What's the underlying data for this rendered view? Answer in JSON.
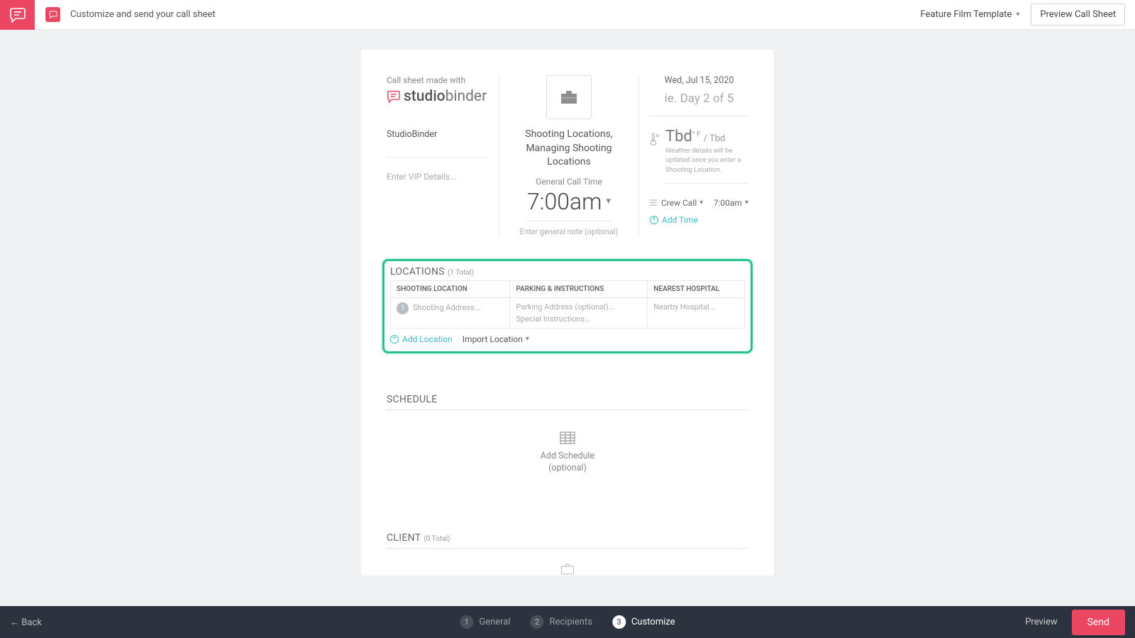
{
  "topbar": {
    "title": "Customize and send your call sheet",
    "template": "Feature Film Template",
    "preview_button": "Preview Call Sheet"
  },
  "header": {
    "made_with": "Call sheet made with",
    "brand_strong": "studio",
    "brand_light": "binder",
    "company": "StudioBinder",
    "vip_placeholder": "Enter VIP Details...",
    "project_title": "Shooting Locations, Managing Shooting Locations",
    "general_call_label": "General Call Time",
    "call_time": "7:00am",
    "general_note_placeholder": "Enter general note (optional)",
    "date": "Wed, Jul 15, 2020",
    "day_of": "ie. Day 2 of 5",
    "weather_tbd_big": "Tbd",
    "weather_tbd_sup": "° F",
    "weather_tbd_small": "/ Tbd",
    "weather_note": "Weather details will be updated once you enter a Shooting Location.",
    "crew_call_label": "Crew Call",
    "crew_call_time": "7:00am",
    "add_time": "Add Time"
  },
  "locations": {
    "title": "LOCATIONS",
    "count": "(1  Total)",
    "col_shoot": "SHOOTING LOCATION",
    "col_park": "PARKING & INSTRUCTIONS",
    "col_hosp": "NEAREST HOSPITAL",
    "row_num": "1",
    "shoot_ph": "Shooting Address...",
    "park_ph": "Parking Address (optional)...",
    "instr_ph": "Special Instructions...",
    "hosp_ph": "Nearby Hospital...",
    "add_location": "Add Location",
    "import_location": "Import Location"
  },
  "schedule": {
    "title": "SCHEDULE",
    "add_label": "Add Schedule",
    "optional": "(optional)"
  },
  "client": {
    "title": "CLIENT",
    "count": "(0  Total)"
  },
  "footer": {
    "back": "← Back",
    "step1": "General",
    "step2": "Recipients",
    "step3": "Customize",
    "preview": "Preview",
    "send": "Send"
  }
}
